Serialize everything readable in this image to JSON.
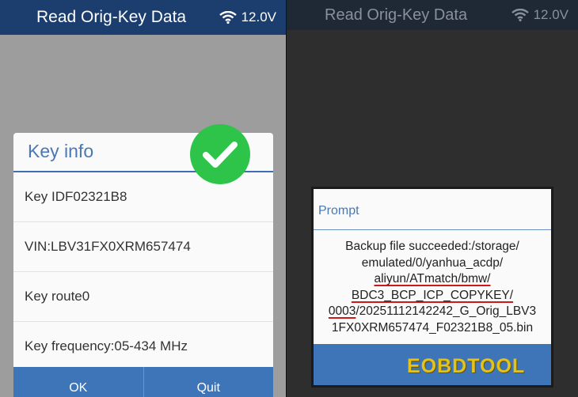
{
  "left_screen": {
    "title": "Read Orig-Key Data",
    "battery_voltage": "12.0V",
    "dialog": {
      "title": "Key info",
      "rows": [
        "Key IDF02321B8",
        "VIN:LBV31FX0XRM657474",
        "Key route0",
        "Key frequency:05-434 MHz"
      ],
      "ok_label": "OK",
      "quit_label": "Quit"
    }
  },
  "right_screen": {
    "title": "Read Orig-Key Data",
    "battery_voltage": "12.0V",
    "dialog": {
      "title": "Prompt",
      "message_lines": [
        "Backup file succeeded:/storage/",
        "emulated/0/yanhua_acdp/",
        "aliyun/ATmatch/bmw/",
        "BDC3_BCP_ICP_COPYKEY/",
        "0003",
        "/20251112142242_G_Orig_LBV3",
        "1FX0XRM657474_F02321B8_05.bin"
      ]
    }
  },
  "watermark": "EOBDTOOL",
  "icons": {
    "success": "check-circle-icon",
    "wifi": "wifi-icon"
  },
  "colors": {
    "title_bar": "#1c3e6e",
    "accent_blue": "#3d75b8",
    "success_green": "#2ec44a",
    "underline_red": "#d01818"
  }
}
